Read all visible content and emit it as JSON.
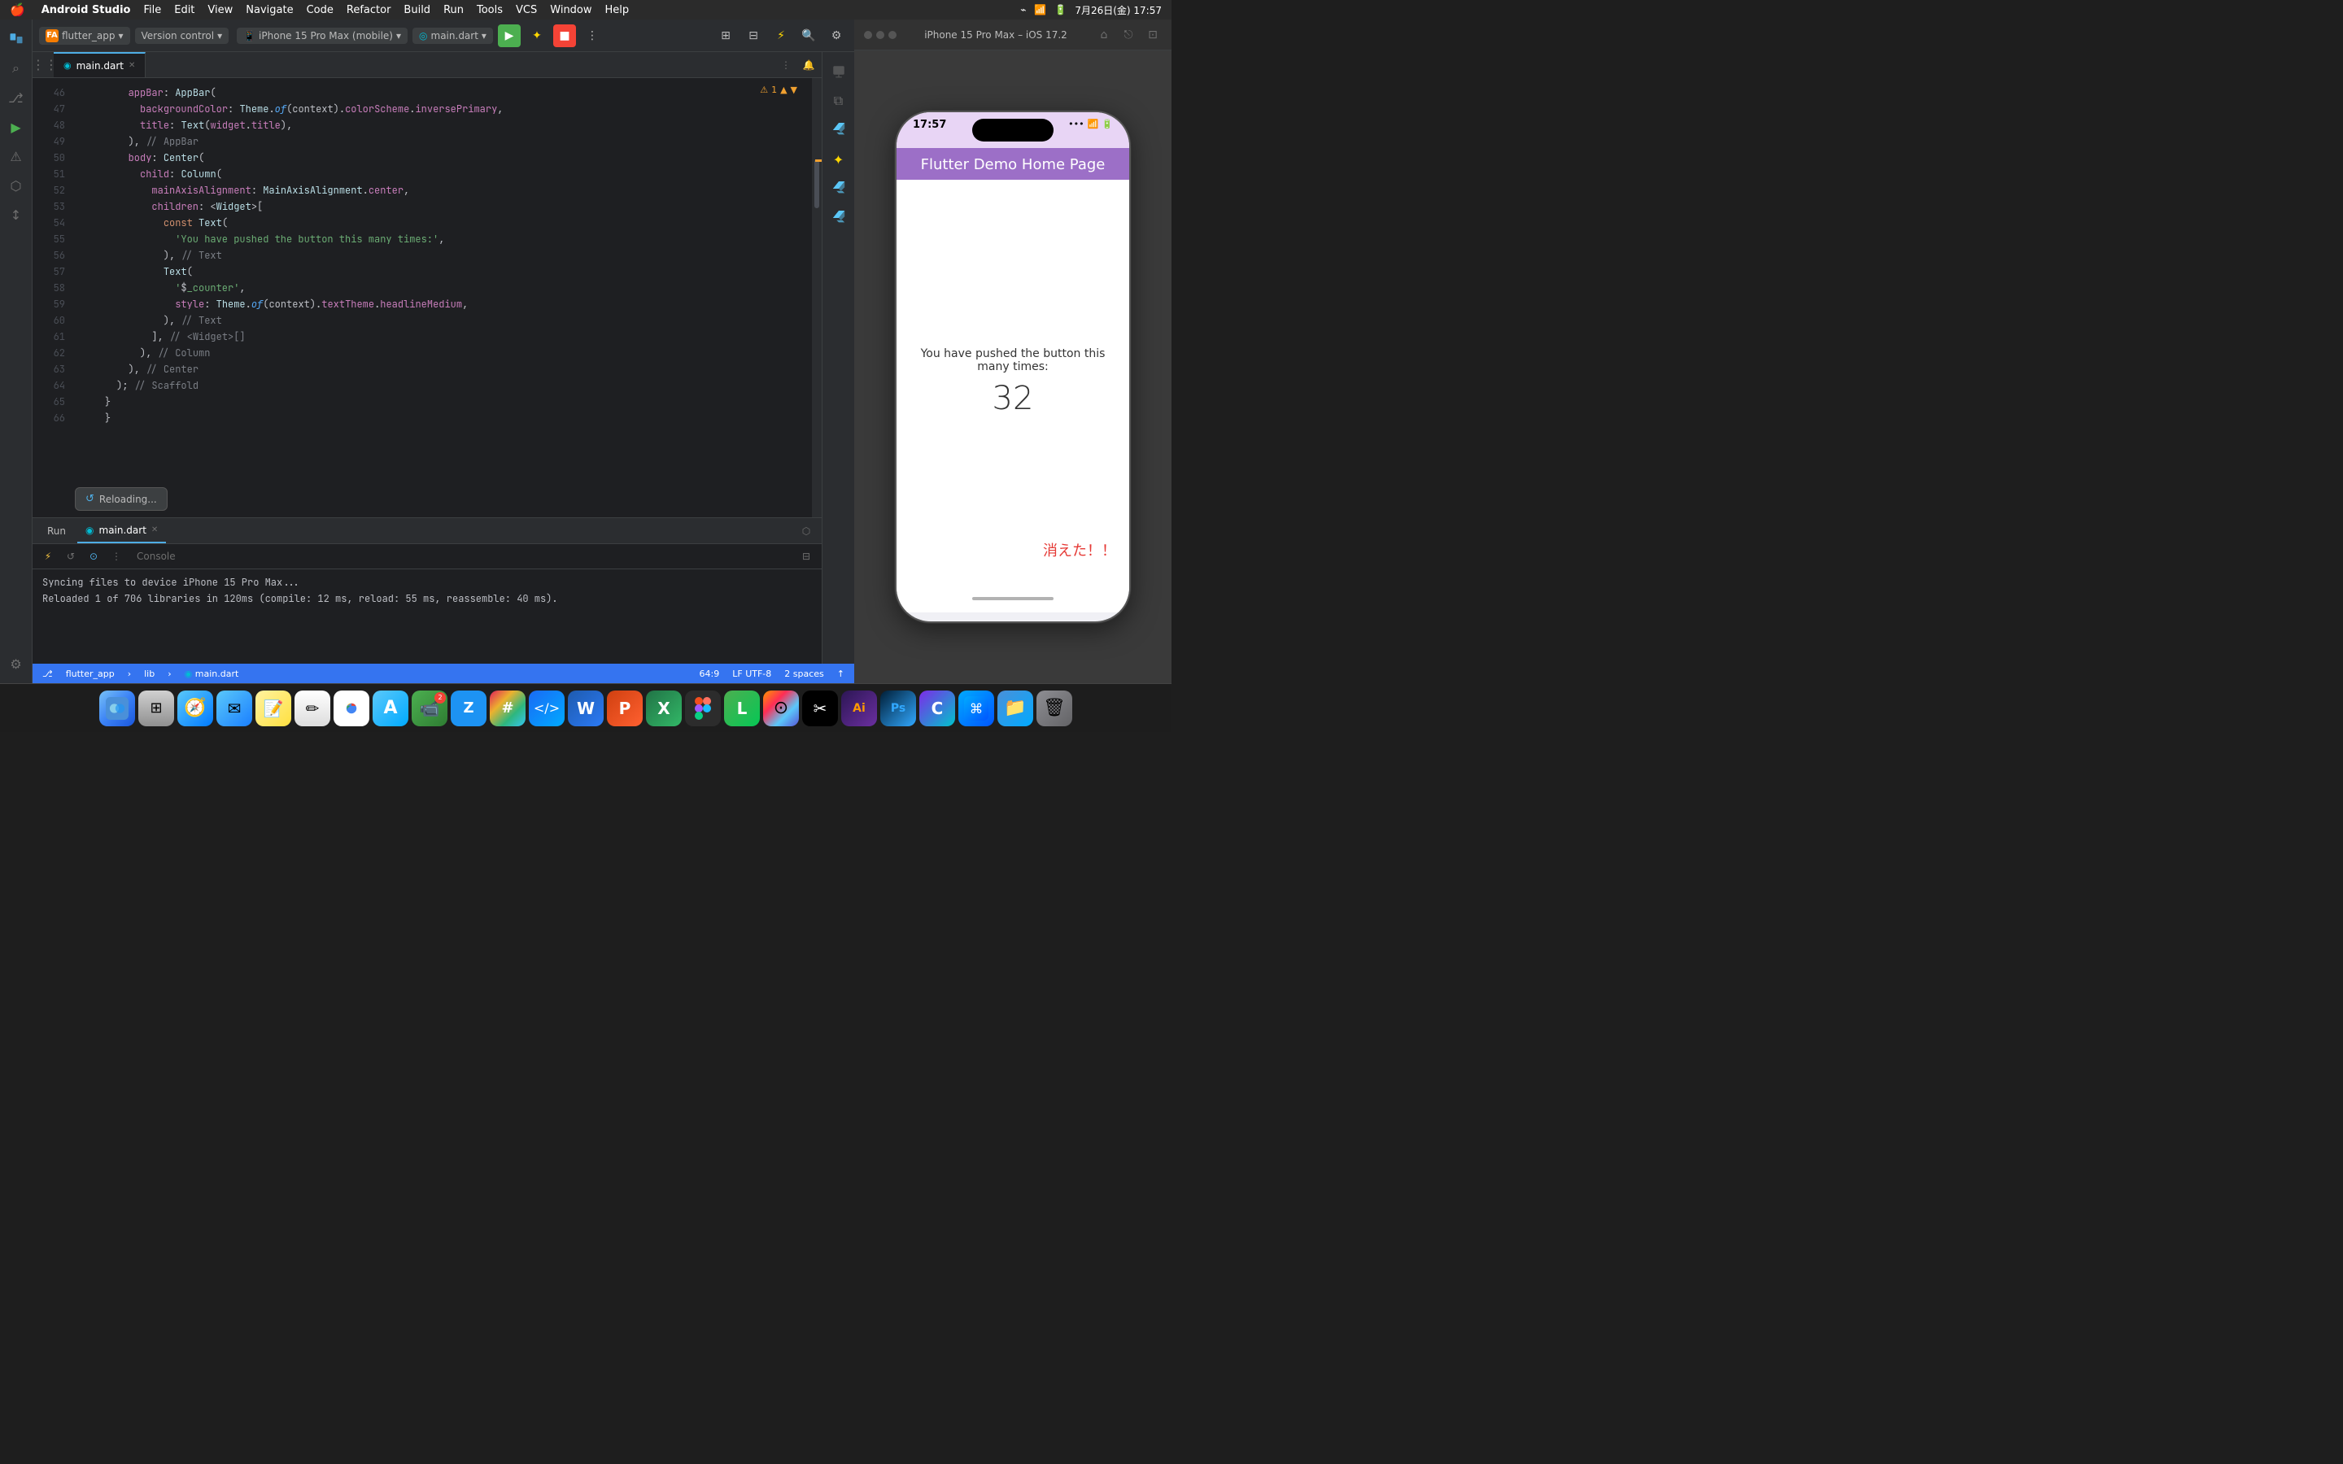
{
  "menubar": {
    "apple": "🍎",
    "app_name": "Android Studio",
    "menus": [
      "File",
      "Edit",
      "View",
      "Navigate",
      "Code",
      "Refactor",
      "Build",
      "Run",
      "Tools",
      "VCS",
      "Window",
      "Help"
    ],
    "time": "7月26日(金) 17:57"
  },
  "ide": {
    "traffic_lights": [
      "red",
      "yellow",
      "green"
    ],
    "project": {
      "icon": "FA",
      "name": "flutter_app",
      "dropdown": true
    },
    "vcs": {
      "label": "Version control",
      "dropdown": true
    },
    "device": {
      "icon": "📱",
      "name": "iPhone 15 Pro Max (mobile)",
      "dropdown": true
    },
    "run_file": {
      "icon": "🎯",
      "name": "main.dart",
      "dropdown": true
    },
    "toolbar_buttons": [
      "run",
      "star",
      "stop",
      "more"
    ],
    "tabs": [
      {
        "name": "main.dart",
        "active": true,
        "icon": "dart"
      }
    ],
    "code": {
      "lines": [
        {
          "num": 46,
          "content": "        appBar: AppBar("
        },
        {
          "num": 47,
          "content": "          backgroundColor: Theme.of(context).colorScheme.inversePrimary,"
        },
        {
          "num": 48,
          "content": "          title: Text(widget.title),"
        },
        {
          "num": 49,
          "content": "        ), // AppBar"
        },
        {
          "num": 50,
          "content": "        body: Center("
        },
        {
          "num": 51,
          "content": "          child: Column("
        },
        {
          "num": 52,
          "content": "            mainAxisAlignment: MainAxisAlignment.center,"
        },
        {
          "num": 53,
          "content": "            children: <Widget>["
        },
        {
          "num": 54,
          "content": "              const Text("
        },
        {
          "num": 55,
          "content": "                'You have pushed the button this many times:',"
        },
        {
          "num": 56,
          "content": "              ), // Text"
        },
        {
          "num": 57,
          "content": "              Text("
        },
        {
          "num": 58,
          "content": "                '$_counter',"
        },
        {
          "num": 59,
          "content": "                style: Theme.of(context).textTheme.headlineMedium,"
        },
        {
          "num": 60,
          "content": "              ), // Text"
        },
        {
          "num": 61,
          "content": "            ], // <Widget>[]"
        },
        {
          "num": 62,
          "content": "          ), // Column"
        },
        {
          "num": 63,
          "content": "        ), // Center"
        },
        {
          "num": 64,
          "content": "      ); // Scaffold"
        },
        {
          "num": 65,
          "content": "    }"
        },
        {
          "num": 66,
          "content": "    }"
        }
      ]
    }
  },
  "bottom_panel": {
    "tabs": [
      {
        "name": "Run",
        "active": false
      },
      {
        "name": "main.dart",
        "active": true,
        "icon": "dart"
      }
    ],
    "console_label": "Console",
    "log_lines": [
      "Syncing files to device iPhone 15 Pro Max...",
      "Reloaded 1 of 706 libraries in 120ms (compile: 12 ms, reload: 55 ms, reassemble: 40 ms)."
    ]
  },
  "status_bar": {
    "project_path": "flutter_app",
    "lib": "lib",
    "file": "main.dart",
    "position": "64:9",
    "encoding": "LF  UTF-8",
    "indent": "2 spaces"
  },
  "reloading_toast": {
    "label": "Reloading..."
  },
  "warning_indicator": {
    "count": "⚠ 1"
  },
  "simulator": {
    "title": "iPhone 15 Pro Max – iOS 17.2",
    "iphone": {
      "time": "17:57",
      "appbar_title": "Flutter Demo Home Page",
      "body_text": "You have pushed the button this many times:",
      "counter": "32",
      "fab_label": "消えた！！"
    }
  },
  "dock": {
    "icons": [
      {
        "id": "finder",
        "label": "Finder",
        "symbol": "🔵",
        "cls": "dock-finder"
      },
      {
        "id": "launchpad",
        "label": "Launchpad",
        "symbol": "⊞",
        "cls": "dock-launchpad"
      },
      {
        "id": "safari",
        "label": "Safari",
        "symbol": "🧭",
        "cls": "dock-safari"
      },
      {
        "id": "mail",
        "label": "Mail",
        "symbol": "✉",
        "cls": "dock-mail"
      },
      {
        "id": "notes",
        "label": "Notes",
        "symbol": "📝",
        "cls": "dock-notes"
      },
      {
        "id": "freeform",
        "label": "Freeform",
        "symbol": "✏",
        "cls": "dock-freeform"
      },
      {
        "id": "chrome",
        "label": "Chrome",
        "symbol": "⬤",
        "cls": "dock-chrome"
      },
      {
        "id": "appstore",
        "label": "App Store",
        "symbol": "A",
        "cls": "dock-appstore"
      },
      {
        "id": "facetime",
        "label": "FaceTime",
        "symbol": "📹",
        "cls": "dock-facetime"
      },
      {
        "id": "zoom",
        "label": "Zoom",
        "symbol": "Z",
        "cls": "dock-zoom"
      },
      {
        "id": "slack",
        "label": "Slack",
        "symbol": "#",
        "cls": "dock-slack"
      },
      {
        "id": "vscode",
        "label": "VS Code",
        "symbol": "</>",
        "cls": "dock-vscode"
      },
      {
        "id": "word",
        "label": "Word",
        "symbol": "W",
        "cls": "dock-word"
      },
      {
        "id": "powerpoint",
        "label": "PowerPoint",
        "symbol": "P",
        "cls": "dock-powerpoint"
      },
      {
        "id": "excel",
        "label": "Excel",
        "symbol": "X",
        "cls": "dock-excel"
      },
      {
        "id": "figma",
        "label": "Figma",
        "symbol": "F",
        "cls": "dock-figma"
      },
      {
        "id": "line",
        "label": "LINE",
        "symbol": "L",
        "cls": "dock-line"
      },
      {
        "id": "photos",
        "label": "Photos",
        "symbol": "⊙",
        "cls": "dock-photos"
      },
      {
        "id": "capcut",
        "label": "CapCut",
        "symbol": "✂",
        "cls": "dock-capcut"
      },
      {
        "id": "ai",
        "label": "Ai",
        "symbol": "Ai",
        "cls": "dock-ai"
      },
      {
        "id": "ps",
        "label": "Photoshop",
        "symbol": "Ps",
        "cls": "dock-ps"
      },
      {
        "id": "canva",
        "label": "Canva",
        "symbol": "C",
        "cls": "dock-canva"
      },
      {
        "id": "xcode",
        "label": "Xcode",
        "symbol": "⌘",
        "cls": "dock-xcode"
      },
      {
        "id": "finder2",
        "label": "Finder2",
        "symbol": "⬡",
        "cls": "dock-finder2"
      },
      {
        "id": "trash",
        "label": "Trash",
        "symbol": "🗑",
        "cls": "dock-trash"
      }
    ],
    "notification_icons": [
      "facetime",
      "zoom"
    ]
  },
  "colors": {
    "accent": "#4eade5",
    "run_green": "#4caf50",
    "stop_red": "#f44336",
    "dart_blue": "#00bcd4",
    "flutter_blue": "#5bc7f7",
    "warning_orange": "#f0a030",
    "fab_red": "#e53935",
    "appbar_purple": "#9c6fc7",
    "status_bar_blue": "#3574f0"
  }
}
